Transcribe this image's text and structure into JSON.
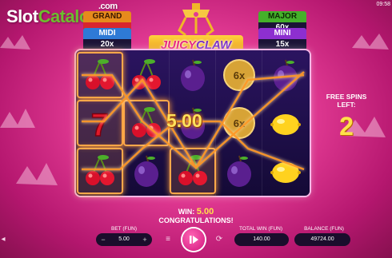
{
  "watermark": {
    "slot": "Slot",
    "catalog": "Catalog",
    "com": ".com"
  },
  "clock": "09:58",
  "jackpots": {
    "grand": {
      "name": "GRAND",
      "value": ""
    },
    "midi": {
      "name": "MIDI",
      "value": "20x"
    },
    "major": {
      "name": "MAJOR",
      "value": "60x"
    },
    "mini": {
      "name": "MINI",
      "value": "15x"
    }
  },
  "logo": {
    "juicy": "JUICY",
    "claw": "CLAW"
  },
  "reels": {
    "columns": [
      [
        "cherry",
        "seven",
        "cherry"
      ],
      [
        "cherry",
        "cherry",
        "plum"
      ],
      [
        "plum",
        "plum",
        "cherry"
      ],
      [
        "multiplier",
        "multiplier",
        "plum"
      ],
      [
        "plum",
        "lemon",
        "lemon"
      ]
    ],
    "multiplier_label": "6x",
    "win_cells": [
      [
        0,
        0
      ],
      [
        0,
        1
      ],
      [
        0,
        2
      ],
      [
        1,
        1
      ],
      [
        2,
        2
      ]
    ]
  },
  "win_amount": "5.00",
  "free_spins": {
    "label_line1": "FREE SPINS",
    "label_line2": "LEFT:",
    "count": "2"
  },
  "win_message": {
    "prefix": "WIN:",
    "amount": "5.00",
    "congrats": "CONGRATULATIONS!"
  },
  "bottom": {
    "bet_label": "BET (FUN)",
    "bet_value": "5.00",
    "total_win_label": "TOTAL WIN (FUN)",
    "total_win_value": "140.00",
    "balance_label": "BALANCE (FUN)",
    "balance_value": "49724.00"
  },
  "colors": {
    "accent": "#e23a93",
    "gold": "#ffe04a",
    "payline": "#ff9a2a"
  }
}
